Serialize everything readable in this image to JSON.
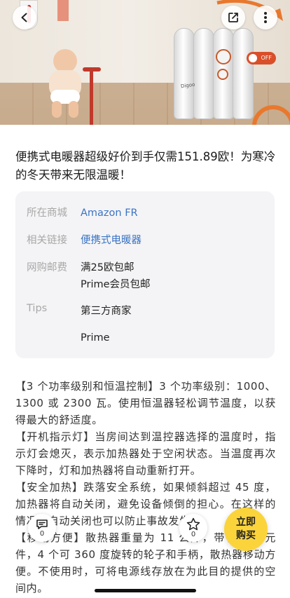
{
  "hero": {
    "toggle_label": "OFF",
    "product_label": "Digoo"
  },
  "nav": {
    "back_icon": "chevron-left-icon",
    "share_icon": "share-icon",
    "more_icon": "more-vertical-icon"
  },
  "post": {
    "title": "便携式电暖器超级好价到手仅需151.89欧！为寒冷的冬天带来无限温暖！"
  },
  "info": {
    "store_label": "所在商城",
    "store_value": "Amazon FR",
    "link_label": "相关链接",
    "link_value": "便携式电暖器",
    "shipping_label": "网购邮费",
    "shipping_line1": "满25欧包邮",
    "shipping_line2": "Prime会员包邮",
    "tips_label": "Tips",
    "tips_line1": "第三方商家",
    "tips_line2": "Prime"
  },
  "content": {
    "p1": "【3 个功率级别和恒温控制】3 个功率级别：1000、1300 或 2300 瓦。使用恒温器轻松调节温度，以获得最大的舒适度。",
    "p2": "【开机指示灯】当房间达到温控器选择的温度时，指示灯会熄灭，表示加热器处于空闲状态。当温度再次下降时，灯和加热器将自动重新打开。",
    "p3": "【安全加热】跌落安全系统，如果倾斜超过 45 度，加热器将自动关闭，避免设备倾倒的担心。在这样的情况下自动关闭也可以防止事故发生。",
    "p4": "【移动方便】散热器重量为 11 公斤，带有 7 个元件，4 个可 360 度旋转的轮子和手柄，散热器移动方便。不使用时，可将电源线存放在为此目的提供的空间内。"
  },
  "actions": {
    "comment_count": "0",
    "favorite_count": "0",
    "buy_line1": "立即",
    "buy_line2": "购买",
    "accent_color": "#fbd43b"
  }
}
